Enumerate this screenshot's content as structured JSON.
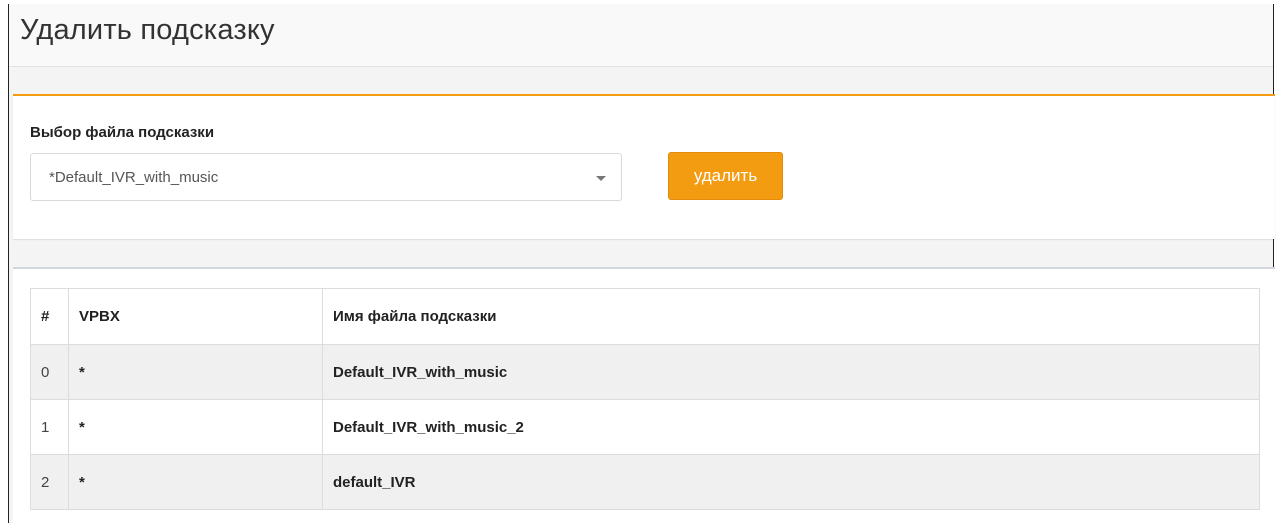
{
  "page": {
    "title": "Удалить подсказку"
  },
  "select_panel": {
    "label": "Выбор файла подсказки",
    "selected_value": "*Default_IVR_with_music",
    "delete_label": "удалить"
  },
  "table": {
    "headers": [
      "#",
      "VPBX",
      "Имя файла подсказки"
    ],
    "rows": [
      {
        "index": "0",
        "vpbx": "*",
        "name": "Default_IVR_with_music"
      },
      {
        "index": "1",
        "vpbx": "*",
        "name": "Default_IVR_with_music_2"
      },
      {
        "index": "2",
        "vpbx": "*",
        "name": "default_IVR"
      }
    ]
  },
  "colors": {
    "accent": "#f39c12",
    "header_bg": "#f9f9f9",
    "row_stripe": "#f0f0f0"
  },
  "icons": {
    "select_caret": "caret-down-icon"
  }
}
